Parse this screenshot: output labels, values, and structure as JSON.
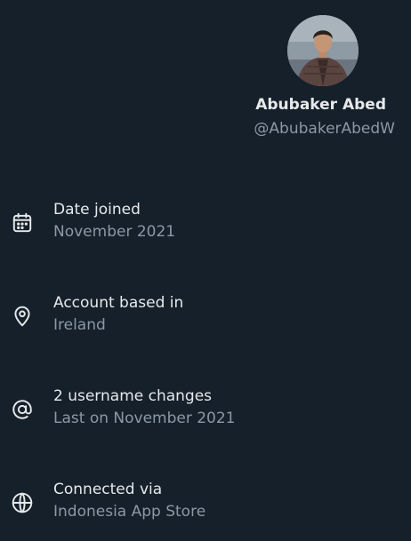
{
  "profile": {
    "display_name": "Abubaker Abed",
    "handle": "@AbubakerAbedW"
  },
  "about": {
    "items": [
      {
        "icon": "calendar-icon",
        "title": "Date joined",
        "value": "November 2021"
      },
      {
        "icon": "location-pin-icon",
        "title": "Account based in",
        "value": "Ireland"
      },
      {
        "icon": "at-sign-icon",
        "title": "2 username changes",
        "value": "Last on November 2021"
      },
      {
        "icon": "globe-icon",
        "title": "Connected via",
        "value": "Indonesia App Store"
      }
    ]
  },
  "colors": {
    "background": "#15202b",
    "primary_text": "#e7e9ea",
    "secondary_text": "#8b98a5"
  }
}
